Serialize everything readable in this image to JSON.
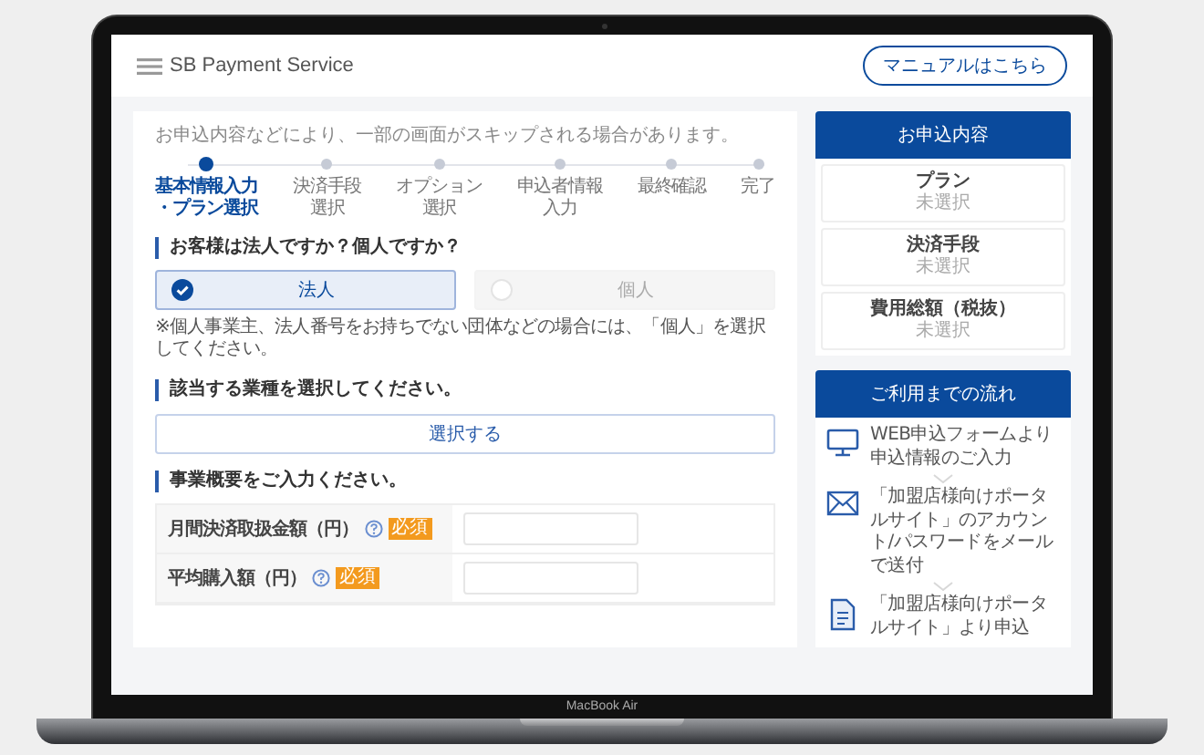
{
  "header": {
    "logo": "SB Payment Service",
    "manual_button": "マニュアルはこちら"
  },
  "form": {
    "notice": "お申込内容などにより、一部の画面がスキップされる場合があります。",
    "steps": [
      {
        "lines": [
          "基本情報入力",
          "・プラン選択"
        ],
        "selected": true
      },
      {
        "lines": [
          "決済手段",
          "選択"
        ],
        "selected": false
      },
      {
        "lines": [
          "オプション",
          "選択"
        ],
        "selected": false
      },
      {
        "lines": [
          "申込者情報",
          "入力"
        ],
        "selected": false
      },
      {
        "lines": [
          "最終確認"
        ],
        "selected": false
      },
      {
        "lines": [
          "完了"
        ],
        "selected": false
      }
    ],
    "customer_type": {
      "heading": "お客様は法人ですか？個人ですか？",
      "options": [
        {
          "label": "法人",
          "selected": true
        },
        {
          "label": "個人",
          "selected": false
        }
      ],
      "note": "※個人事業主、法人番号をお持ちでない団体などの場合には、「個人」を選択してください。"
    },
    "industry": {
      "heading": "該当する業種を選択してください。",
      "button": "選択する"
    },
    "business": {
      "heading": "事業概要をご入力ください。",
      "rows": [
        {
          "label": "月間決済取扱金額（円）",
          "required": "必須"
        },
        {
          "label": "平均購入額（円）",
          "required": "必須"
        }
      ]
    }
  },
  "sidebar": {
    "summary": {
      "title": "お申込内容",
      "items": [
        {
          "label": "プラン",
          "value": "未選択"
        },
        {
          "label": "決済手段",
          "value": "未選択"
        },
        {
          "label": "費用総額（税抜）",
          "value": "未選択"
        }
      ]
    },
    "flow": {
      "title": "ご利用までの流れ",
      "steps": [
        {
          "kind": "monitor",
          "text": "WEB申込フォームより申込情報のご入力"
        },
        {
          "kind": "mail",
          "text": "「加盟店様向けポータルサイト」のアカウント/パスワードをメールで送付"
        },
        {
          "kind": "document",
          "text": "「加盟店様向けポータルサイト」より申込"
        }
      ]
    }
  },
  "device": {
    "label": "MacBook Air"
  }
}
